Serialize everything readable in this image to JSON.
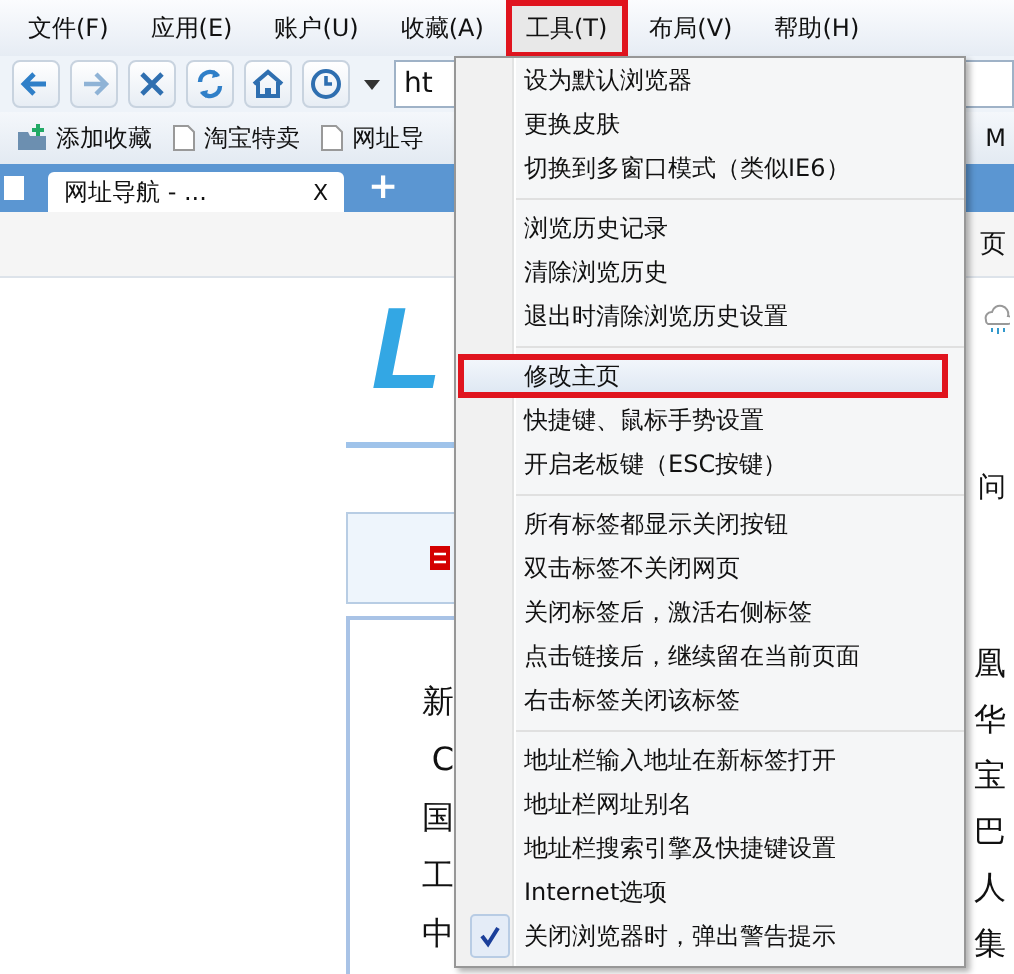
{
  "menu_bar": [
    {
      "label": "文件(F)",
      "selected": false
    },
    {
      "label": "应用(E)",
      "selected": false
    },
    {
      "label": "账户(U)",
      "selected": false
    },
    {
      "label": "收藏(A)",
      "selected": false
    },
    {
      "label": "工具(T)",
      "selected": true
    },
    {
      "label": "布局(V)",
      "selected": false
    },
    {
      "label": "帮助(H)",
      "selected": false
    }
  ],
  "toolbar": {
    "buttons": [
      {
        "kind": "back"
      },
      {
        "kind": "forward"
      },
      {
        "kind": "stop"
      },
      {
        "kind": "refresh"
      },
      {
        "kind": "home"
      },
      {
        "kind": "history"
      }
    ],
    "address": "ht"
  },
  "bookmarks": [
    {
      "kind": "add",
      "label": "添加收藏"
    },
    {
      "kind": "page",
      "label": "淘宝特卖"
    },
    {
      "kind": "page",
      "label": "网址导"
    },
    {
      "kind": "page-right",
      "label": "M"
    }
  ],
  "tabs": [
    {
      "title": "网址导航 - ...",
      "close": "X"
    }
  ],
  "new_tab": "+",
  "page": {
    "logo": "L",
    "right_texts": [
      "页"
    ],
    "ask": "问",
    "left_column": [
      "新",
      "C",
      "国",
      "工",
      "中"
    ],
    "right_column": [
      "凰",
      "华",
      "宝",
      "巴",
      "人",
      "集"
    ]
  },
  "dropdown": {
    "groups": [
      [
        {
          "label": "设为默认浏览器",
          "selected": false,
          "checked": false
        },
        {
          "label": "更换皮肤",
          "selected": false,
          "checked": false
        },
        {
          "label": "切换到多窗口模式（类似IE6）",
          "selected": false,
          "checked": false
        }
      ],
      [
        {
          "label": "浏览历史记录",
          "selected": false,
          "checked": false
        },
        {
          "label": "清除浏览历史",
          "selected": false,
          "checked": false
        },
        {
          "label": "退出时清除浏览历史设置",
          "selected": false,
          "checked": false
        }
      ],
      [
        {
          "label": "修改主页",
          "selected": true,
          "checked": false
        },
        {
          "label": "快捷键、鼠标手势设置",
          "selected": false,
          "checked": false
        },
        {
          "label": "开启老板键（ESC按键）",
          "selected": false,
          "checked": false
        }
      ],
      [
        {
          "label": "所有标签都显示关闭按钮",
          "selected": false,
          "checked": false
        },
        {
          "label": "双击标签不关闭网页",
          "selected": false,
          "checked": false
        },
        {
          "label": "关闭标签后，激活右侧标签",
          "selected": false,
          "checked": false
        },
        {
          "label": "点击链接后，继续留在当前页面",
          "selected": false,
          "checked": false
        },
        {
          "label": "右击标签关闭该标签",
          "selected": false,
          "checked": false
        }
      ],
      [
        {
          "label": "地址栏输入地址在新标签打开",
          "selected": false,
          "checked": false
        },
        {
          "label": "地址栏网址别名",
          "selected": false,
          "checked": false
        },
        {
          "label": "地址栏搜索引擎及快捷键设置",
          "selected": false,
          "checked": false
        },
        {
          "label": "Internet选项",
          "selected": false,
          "checked": false
        },
        {
          "label": "关闭浏览器时，弹出警告提示",
          "selected": false,
          "checked": true
        }
      ]
    ]
  }
}
